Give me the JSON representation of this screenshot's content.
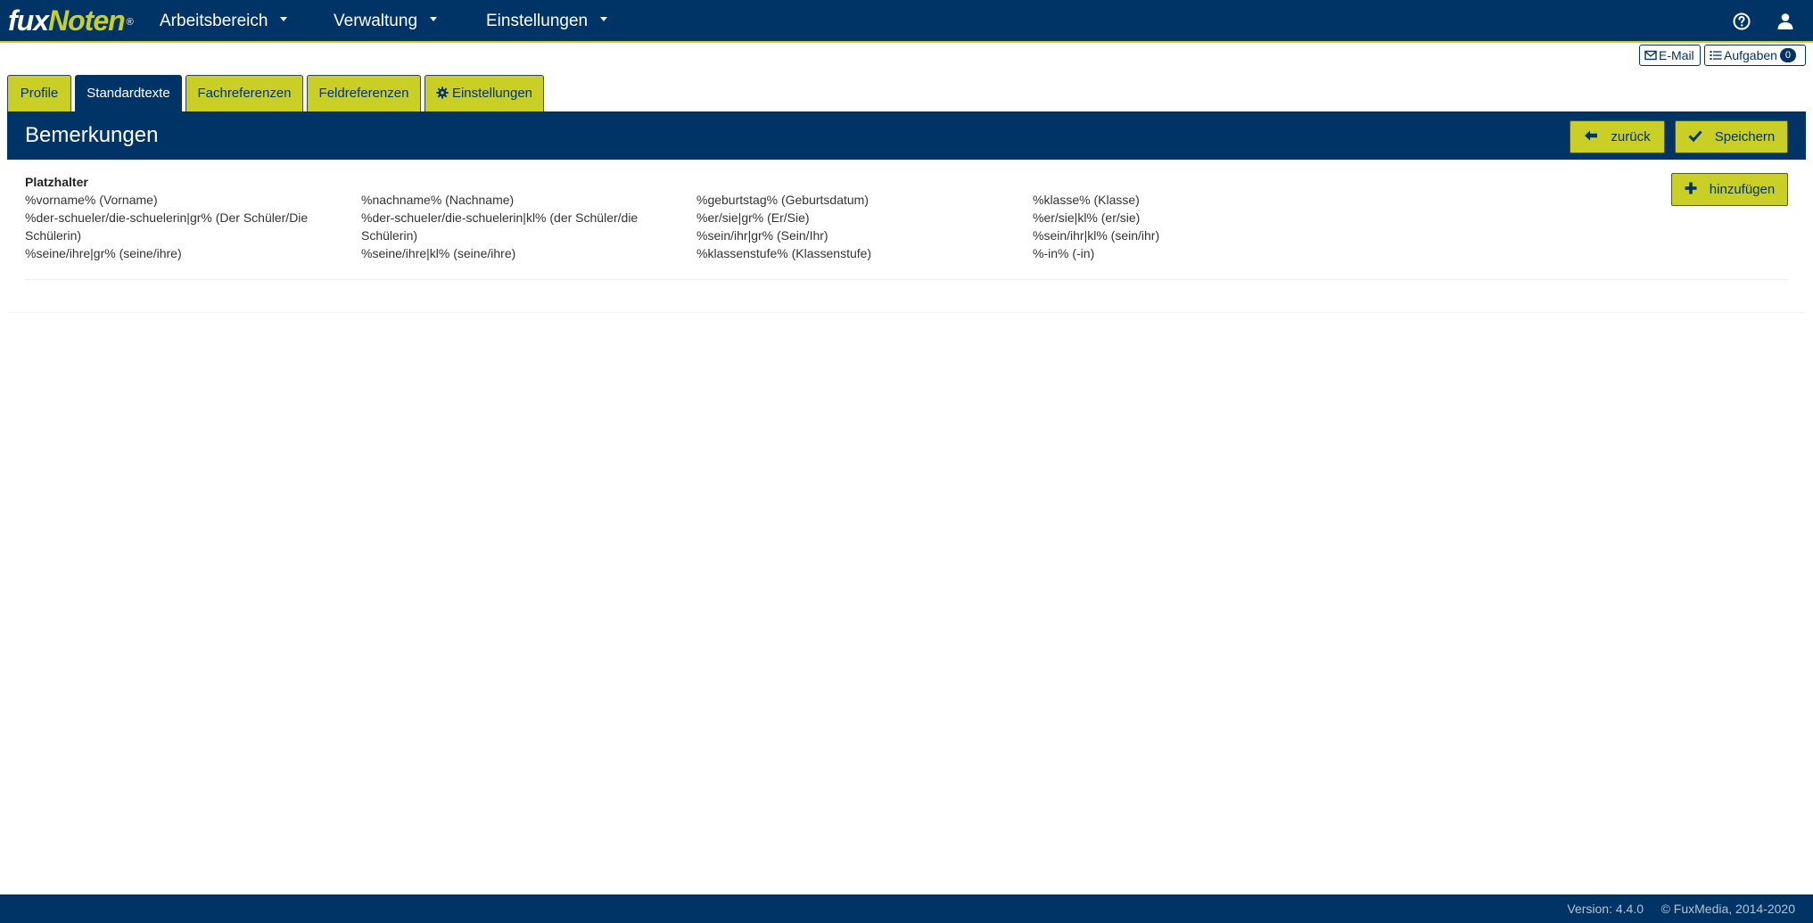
{
  "app": {
    "logo_fux": "fux",
    "logo_noten": "Noten",
    "logo_reg": "®"
  },
  "nav": {
    "items": [
      {
        "label": "Arbeitsbereich"
      },
      {
        "label": "Verwaltung"
      },
      {
        "label": "Einstellungen"
      }
    ],
    "help_icon": "question-circle-icon",
    "user_icon": "user-icon"
  },
  "toolbar": {
    "email_label": "E-Mail",
    "tasks_label": "Aufgaben",
    "tasks_count": "0"
  },
  "tabs": [
    {
      "label": "Profile",
      "active": false
    },
    {
      "label": "Standardtexte",
      "active": true
    },
    {
      "label": "Fachreferenzen",
      "active": false
    },
    {
      "label": "Feldreferenzen",
      "active": false
    },
    {
      "label": "Einstellungen",
      "active": false,
      "icon": "gear-icon"
    }
  ],
  "panel": {
    "title": "Bemerkungen",
    "back_label": "zurück",
    "save_label": "Speichern",
    "add_label": "hinzufügen"
  },
  "placeholders": {
    "label": "Platzhalter",
    "items": [
      "%vorname% (Vorname)",
      "%nachname% (Nachname)",
      "%geburtstag% (Geburtsdatum)",
      "%klasse% (Klasse)",
      "%der-schueler/die-schuelerin|gr% (Der Schüler/Die Schülerin)",
      "%der-schueler/die-schuelerin|kl% (der Schüler/die Schülerin)",
      "%er/sie|gr% (Er/Sie)",
      "%er/sie|kl% (er/sie)",
      "%sein/ihr|gr% (Sein/Ihr)",
      "%sein/ihr|kl% (sein/ihr)",
      "%seine/ihre|gr% (seine/ihre)",
      "%seine/ihre|kl% (seine/ihre)",
      "%klassenstufe% (Klassenstufe)",
      "%-in% (-in)"
    ]
  },
  "footer": {
    "version": "Version: 4.4.0",
    "copyright": "© FuxMedia, 2014-2020"
  },
  "colors": {
    "primary": "#003366",
    "accent": "#c9cf24"
  }
}
